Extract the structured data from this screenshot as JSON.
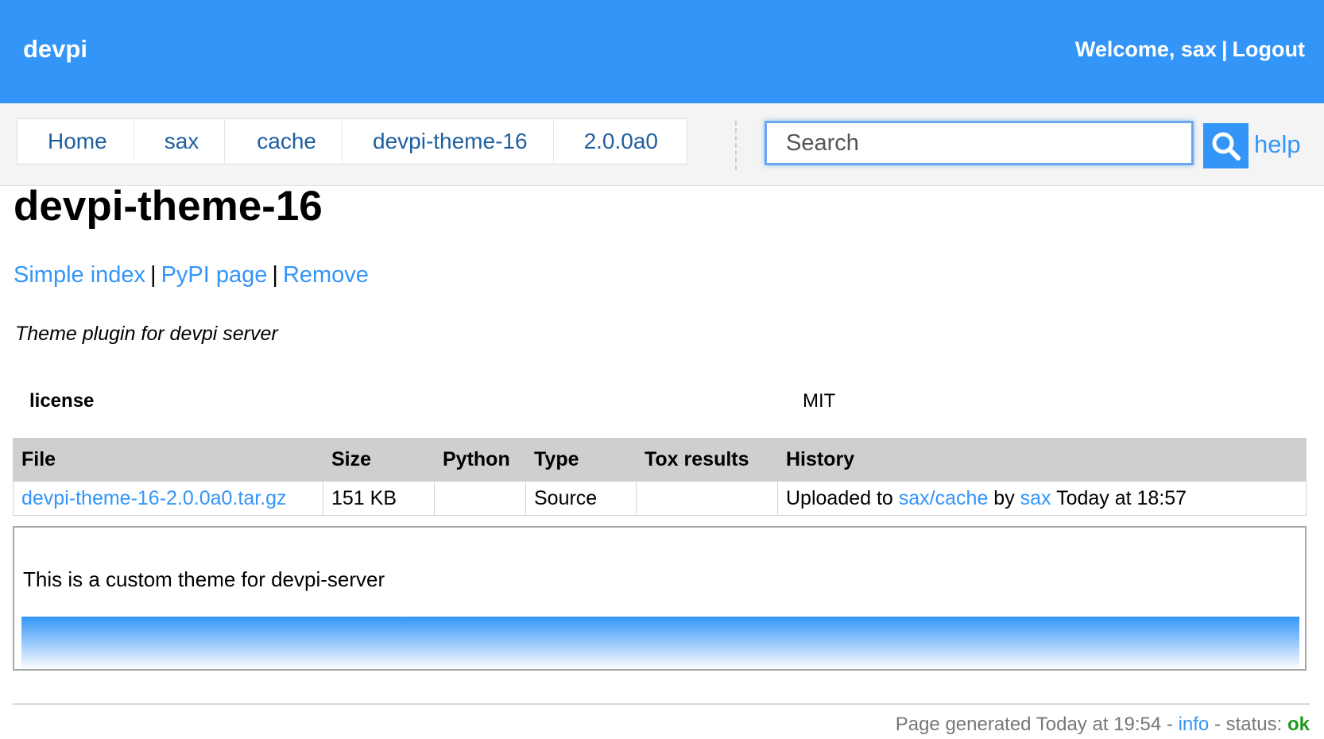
{
  "header": {
    "brand": "devpi",
    "welcome": "Welcome, sax",
    "separator": "|",
    "logout": "Logout"
  },
  "breadcrumbs": [
    "Home",
    "sax",
    "cache",
    "devpi-theme-16",
    "2.0.0a0"
  ],
  "search": {
    "placeholder": "Search",
    "icon": "magnifier-icon"
  },
  "help_label": "help",
  "page_title": "devpi-theme-16",
  "links": {
    "simple_index": "Simple index",
    "pypi_page": "PyPI page",
    "remove": "Remove",
    "separator": "|"
  },
  "summary": "Theme plugin for devpi server",
  "metadata": {
    "license_key": "license",
    "license_value": "MIT"
  },
  "files_table": {
    "headers": [
      "File",
      "Size",
      "Python",
      "Type",
      "Tox results",
      "History"
    ],
    "rows": [
      {
        "file": "devpi-theme-16-2.0.0a0.tar.gz",
        "size": "151 KB",
        "python": "",
        "type": "Source",
        "tox": "",
        "history_prefix": "Uploaded to",
        "history_index": "sax/cache",
        "history_by": "by",
        "history_user": "sax",
        "history_time": "Today at 18:57"
      }
    ]
  },
  "description": {
    "text": "This is a custom theme for devpi-server"
  },
  "footer": {
    "generated": "Page generated Today at 19:54",
    "dash": "-",
    "info": "info",
    "status_label": "status:",
    "status_value": "ok"
  },
  "colors": {
    "accent": "#3395f8",
    "status_ok": "#1f9a1f"
  }
}
